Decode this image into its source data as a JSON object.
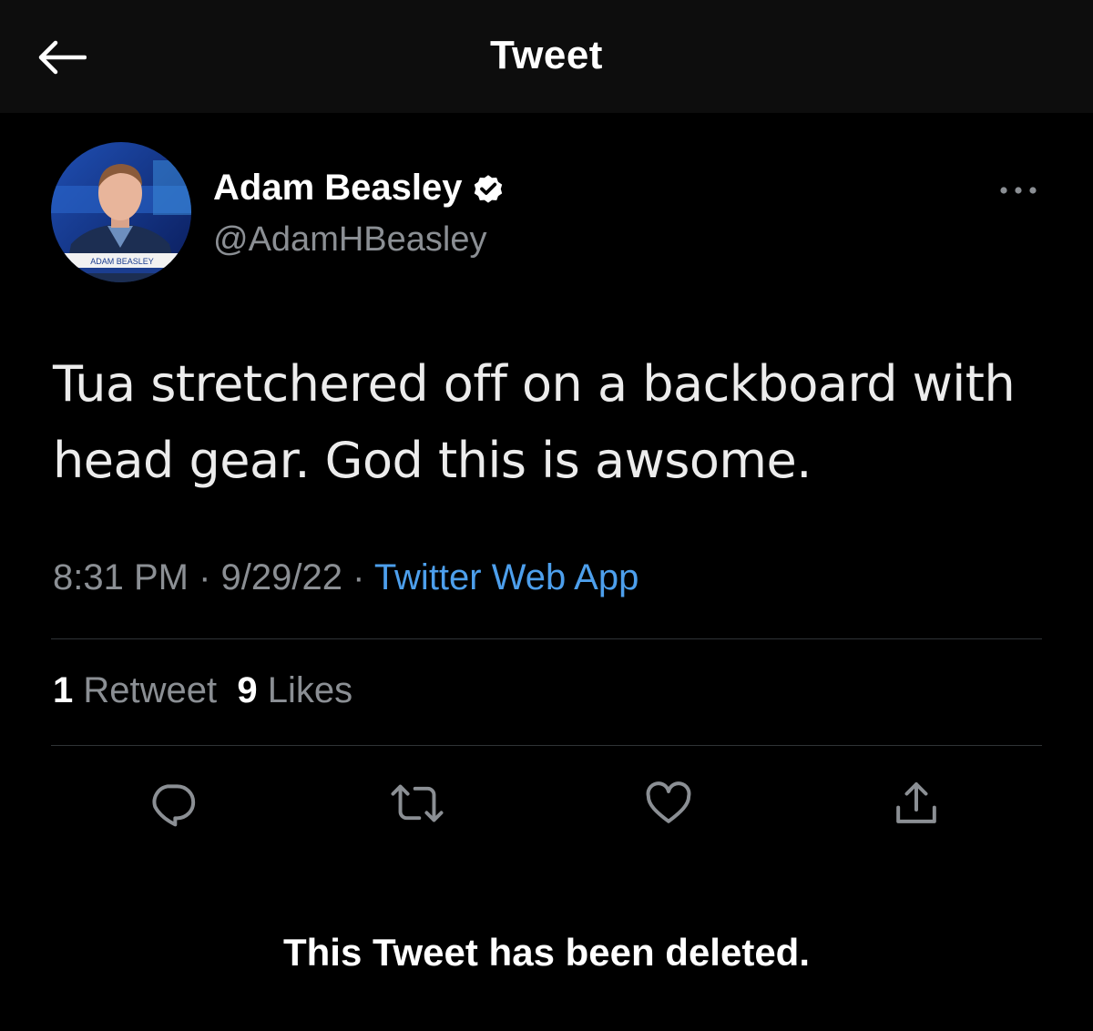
{
  "header": {
    "title": "Tweet",
    "back_icon": "arrow-left-icon"
  },
  "author": {
    "display_name": "Adam Beasley",
    "handle": "@AdamHBeasley",
    "verified": true,
    "verified_icon": "verified-badge-icon",
    "avatar_caption": "ADAM BEASLEY"
  },
  "tweet": {
    "text": "Tua stretchered off on a backboard with head gear. God this is awsome.",
    "time": "8:31 PM",
    "separator": " · ",
    "date": "9/29/22",
    "source": "Twitter Web App"
  },
  "stats": {
    "retweets_count": "1",
    "retweets_label": "Retweet",
    "likes_count": "9",
    "likes_label": "Likes"
  },
  "actions": [
    {
      "name": "reply",
      "icon": "reply-icon"
    },
    {
      "name": "retweet",
      "icon": "retweet-icon"
    },
    {
      "name": "like",
      "icon": "heart-icon"
    },
    {
      "name": "share",
      "icon": "share-icon"
    }
  ],
  "notice": {
    "text": "This Tweet has been deleted."
  },
  "colors": {
    "background": "#000000",
    "header_background": "#0d0d0d",
    "text_primary": "#ffffff",
    "text_secondary": "#8b8f94",
    "link": "#4d9fec",
    "divider": "#2f3336",
    "icon": "#8b8f94"
  }
}
